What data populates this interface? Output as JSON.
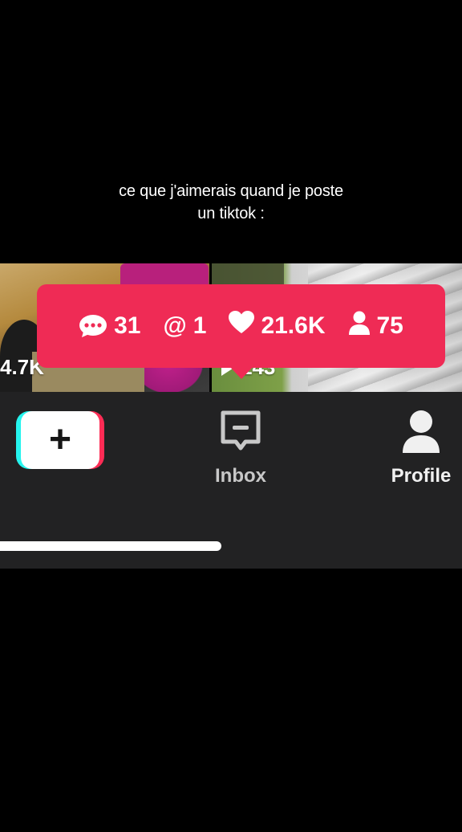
{
  "caption": {
    "line1": "ce que j'aimerais quand je poste",
    "line2": "un tiktok :"
  },
  "thumbnails": [
    {
      "views": "4.7K"
    },
    {
      "views": "143"
    }
  ],
  "notification": {
    "comments": "31",
    "mentions_symbol": "@",
    "mentions": "1",
    "likes": "21.6K",
    "followers": "75",
    "color": "#ef2b55"
  },
  "tabbar": {
    "create_icon": "plus-icon",
    "inbox_label": "Inbox",
    "profile_label": "Profile"
  },
  "colors": {
    "tiktok_cyan": "#25f4ee",
    "tiktok_red": "#fe2c55",
    "bar_bg": "#222223"
  }
}
